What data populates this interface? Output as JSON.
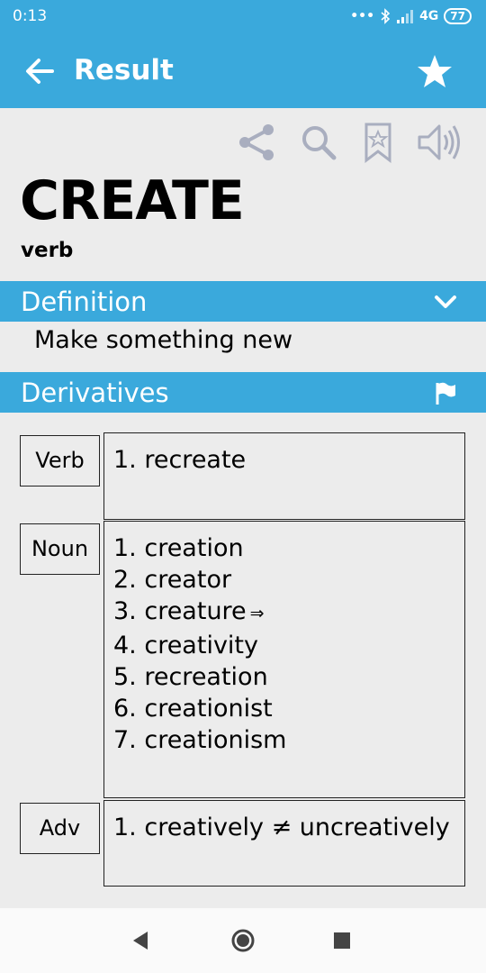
{
  "status_bar": {
    "time": "0:13",
    "network": "4G",
    "battery": "77"
  },
  "app_bar": {
    "title": "Result",
    "back_icon": "arrow-left-icon",
    "favorite_icon": "star-icon"
  },
  "toolbar": {
    "icons": [
      "share-icon",
      "search-icon",
      "bookmark-icon",
      "speaker-icon"
    ]
  },
  "entry": {
    "word": "CREATE",
    "part_of_speech": "verb"
  },
  "definition_section": {
    "title": "Definition",
    "text": "Make something new"
  },
  "derivatives_section": {
    "title": "Derivatives",
    "groups": [
      {
        "pos": "Verb",
        "items": [
          "1. recreate"
        ]
      },
      {
        "pos": "Noun",
        "items": [
          "1. creation",
          "2. creator",
          "3. creature",
          "4. creativity",
          "5. recreation",
          "6. creationist",
          "7. creationism"
        ],
        "creature_marker": "⇒"
      },
      {
        "pos": "Adv",
        "items": [
          "1. creatively ≠ uncreatively"
        ]
      }
    ]
  },
  "colors": {
    "accent": "#3aa9dc",
    "background": "#ececec",
    "icon_gray": "#a9aebf"
  },
  "nav_bar": {
    "icons": [
      "back-triangle-icon",
      "home-circle-icon",
      "recents-square-icon"
    ]
  }
}
